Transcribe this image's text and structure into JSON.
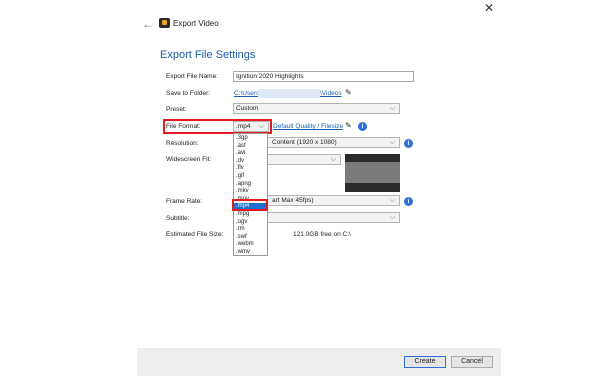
{
  "window": {
    "title": "Export Video",
    "back_glyph": "←",
    "close_glyph": "✕"
  },
  "heading": "Export File Settings",
  "fields": {
    "file_name": {
      "label": "Export File Name:",
      "value": "Ignition 2020 Highlights"
    },
    "save_to": {
      "label": "Save to Folder:",
      "path_start": "C:\\Users\\",
      "path_end": "\\Videos"
    },
    "preset": {
      "label": "Preset:",
      "value": "Custom"
    },
    "file_format": {
      "label": "File Format:",
      "value": ".mp4",
      "quality_link": "Default Quality / Filesize"
    },
    "resolution": {
      "label": "Resolution:",
      "value_visible": "Content (1920 x 1080)"
    },
    "widescreen": {
      "label": "Widescreen Fit:"
    },
    "frame_rate": {
      "label": "Frame Rate:",
      "value_visible": "art Max 45fps)"
    },
    "subtitle": {
      "label": "Subtitle:"
    },
    "estimated_size": {
      "label": "Estimated File Size:",
      "value": "121.0GB free on C:\\"
    }
  },
  "format_options": [
    ".3gp",
    ".asf",
    ".avi",
    ".dv",
    ".flv",
    ".gif",
    ".apng",
    ".mkv",
    ".mov",
    ".mp4",
    ".mpg",
    ".ogv",
    ".rm",
    ".swf",
    ".webm",
    ".wmv"
  ],
  "selected_format_index": 9,
  "icons": {
    "pencil": "✎",
    "info": "i",
    "chevron": "⌵"
  },
  "buttons": {
    "create": "Create",
    "cancel": "Cancel"
  },
  "colors": {
    "accent": "#1e5aa8",
    "highlight": "#e01b24",
    "selection": "#1f6fd1"
  }
}
